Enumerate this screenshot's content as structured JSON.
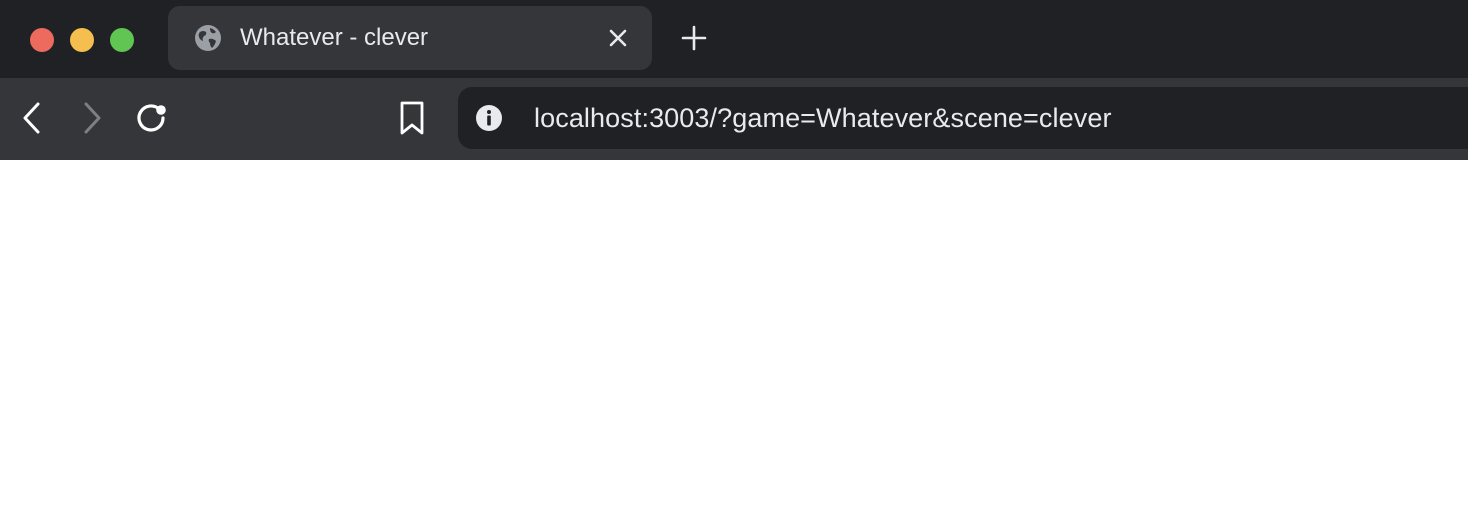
{
  "window_controls": {
    "close_color": "#ed6a5e",
    "minimize_color": "#f5bf4f",
    "maximize_color": "#61c554"
  },
  "tab": {
    "title": "Whatever - clever",
    "favicon": "globe-icon",
    "close_icon": "close-icon"
  },
  "new_tab_icon": "plus-icon",
  "toolbar": {
    "back_icon": "chevron-left-icon",
    "forward_icon": "chevron-right-icon",
    "reload_icon": "reload-icon",
    "bookmark_icon": "bookmark-icon"
  },
  "omnibox": {
    "info_icon": "info-icon",
    "url": "localhost:3003/?game=Whatever&scene=clever"
  },
  "colors": {
    "tabstrip_bg": "#202124",
    "toolbar_bg": "#35363a",
    "active_tab_bg": "#35363a",
    "omnibox_bg": "#202124",
    "text": "#e8eaed",
    "content_bg": "#ffffff"
  }
}
